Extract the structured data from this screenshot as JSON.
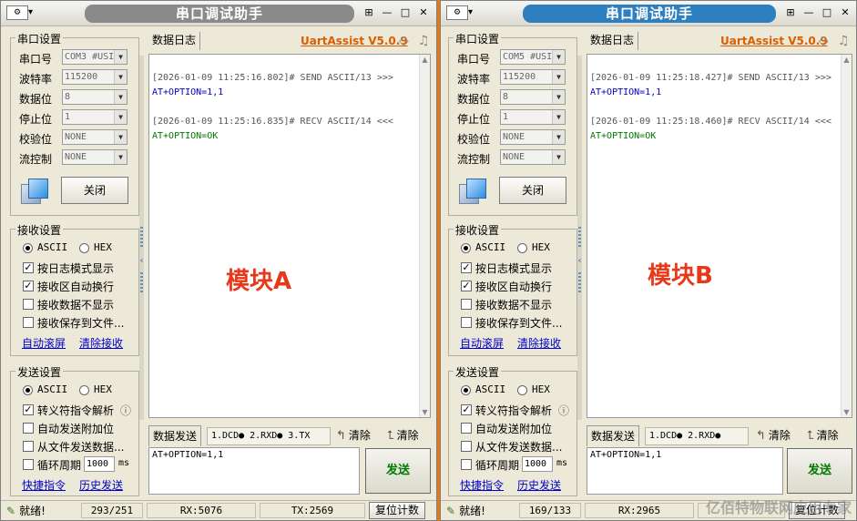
{
  "windows": [
    {
      "title": "串口调试助手",
      "brand": "UartAssist V5.0.9",
      "port_settings": {
        "group_title": "串口设置",
        "port_label": "串口号",
        "port_value": "COM3 #USI",
        "baud_label": "波特率",
        "baud_value": "115200",
        "databits_label": "数据位",
        "databits_value": "8",
        "stopbits_label": "停止位",
        "stopbits_value": "1",
        "parity_label": "校验位",
        "parity_value": "NONE",
        "flow_label": "流控制",
        "flow_value": "NONE",
        "close_button": "关闭"
      },
      "receive_settings": {
        "group_title": "接收设置",
        "ascii": "ASCII",
        "hex": "HEX",
        "opt_log_mode": "按日志模式显示",
        "opt_auto_wrap": "接收区自动换行",
        "opt_hide": "接收数据不显示",
        "opt_save_file": "接收保存到文件...",
        "link_auto_scroll": "自动滚屏",
        "link_clear": "清除接收"
      },
      "send_settings": {
        "group_title": "发送设置",
        "ascii": "ASCII",
        "hex": "HEX",
        "opt_escape": "转义符指令解析",
        "opt_append": "自动发送附加位",
        "opt_from_file": "从文件发送数据...",
        "opt_cycle": "循环周期",
        "cycle_value": "1000",
        "cycle_unit": "ms",
        "link_shortcut": "快捷指令",
        "link_history": "历史发送"
      },
      "log_tab": "数据日志",
      "log": {
        "send_header": "[2026-01-09 11:25:16.802]# SEND ASCII/13 >>>",
        "send_body": "AT+OPTION=1,1",
        "recv_header": "[2026-01-09 11:25:16.835]# RECV ASCII/14 <<<",
        "recv_body": "AT+OPTION=OK",
        "module_label": "模块A"
      },
      "send_tab": "数据发送",
      "send_lines": "1.DCD● 2.RXD● 3.TX",
      "clear1": "清除",
      "clear2": "清除",
      "send_text": "AT+OPTION=1,1",
      "send_button": "发送",
      "status": {
        "ready": "就绪!",
        "counter": "293/251",
        "rx": "RX:5076",
        "tx": "TX:2569",
        "reset": "复位计数"
      }
    },
    {
      "title": "串口调试助手",
      "brand": "UartAssist V5.0.9",
      "port_settings": {
        "group_title": "串口设置",
        "port_label": "串口号",
        "port_value": "COM5 #USI",
        "baud_label": "波特率",
        "baud_value": "115200",
        "databits_label": "数据位",
        "databits_value": "8",
        "stopbits_label": "停止位",
        "stopbits_value": "1",
        "parity_label": "校验位",
        "parity_value": "NONE",
        "flow_label": "流控制",
        "flow_value": "NONE",
        "close_button": "关闭"
      },
      "receive_settings": {
        "group_title": "接收设置",
        "ascii": "ASCII",
        "hex": "HEX",
        "opt_log_mode": "按日志模式显示",
        "opt_auto_wrap": "接收区自动换行",
        "opt_hide": "接收数据不显示",
        "opt_save_file": "接收保存到文件...",
        "link_auto_scroll": "自动滚屏",
        "link_clear": "清除接收"
      },
      "send_settings": {
        "group_title": "发送设置",
        "ascii": "ASCII",
        "hex": "HEX",
        "opt_escape": "转义符指令解析",
        "opt_append": "自动发送附加位",
        "opt_from_file": "从文件发送数据...",
        "opt_cycle": "循环周期",
        "cycle_value": "1000",
        "cycle_unit": "ms",
        "link_shortcut": "快捷指令",
        "link_history": "历史发送"
      },
      "log_tab": "数据日志",
      "log": {
        "send_header": "[2026-01-09 11:25:18.427]# SEND ASCII/13 >>>",
        "send_body": "AT+OPTION=1,1",
        "recv_header": "[2026-01-09 11:25:18.460]# RECV ASCII/14 <<<",
        "recv_body": "AT+OPTION=OK",
        "module_label": "模块B"
      },
      "send_tab": "数据发送",
      "send_lines": "1.DCD● 2.RXD●",
      "clear1": "清除",
      "clear2": "清除",
      "send_text": "AT+OPTION=1,1",
      "send_button": "发送",
      "status": {
        "ready": "就绪!",
        "counter": "169/133",
        "rx": "RX:2965",
        "tx": "",
        "reset": "复位计数"
      }
    }
  ],
  "watermark": "亿佰特物联网应用专家",
  "colors": {
    "accent_orange": "#e07a1a",
    "module_label": "#e8381a",
    "sent_text": "#0000cc",
    "recv_text": "#007700",
    "send_button_text": "#007a00"
  }
}
